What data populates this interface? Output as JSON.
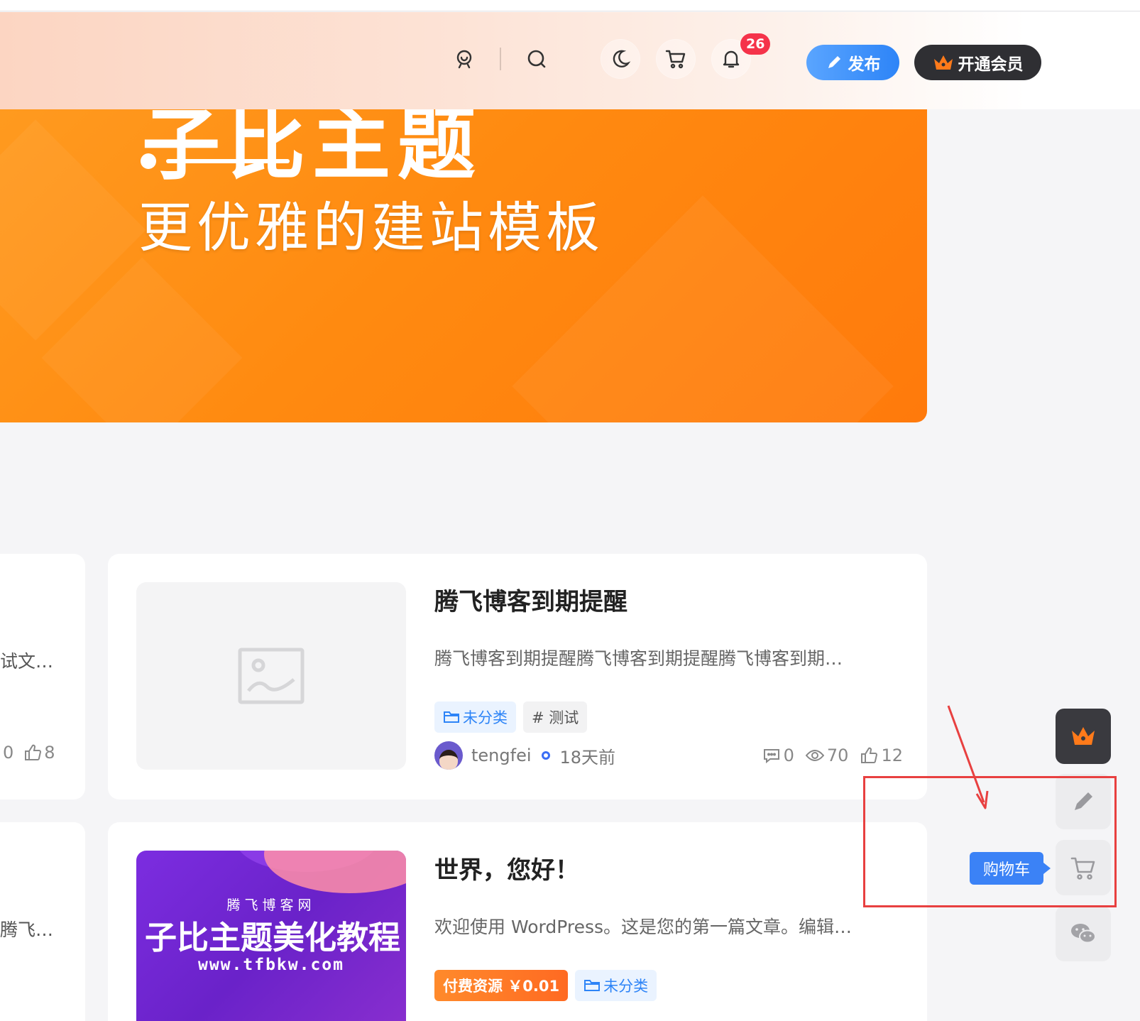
{
  "header": {
    "badge_count": "26",
    "publish_label": "发布",
    "vip_label": "开通会员"
  },
  "banner": {
    "title_partial": "子比主题",
    "subtitle": "更优雅的建站模板"
  },
  "left_column": {
    "row1_excerpt": "试文…",
    "row1_comments": "0",
    "row1_likes": "8",
    "row2_excerpt": "腾飞…"
  },
  "posts": [
    {
      "title": "腾飞博客到期提醒",
      "excerpt": "腾飞博客到期提醒腾飞博客到期提醒腾飞博客到期…",
      "tags": [
        "未分类",
        "# 测试"
      ],
      "author": "tengfei",
      "time": "18天前",
      "comments": "0",
      "views": "70",
      "likes": "12"
    },
    {
      "title": "世界，您好！",
      "excerpt": "欢迎使用 WordPress。这是您的第一篇文章。编辑…",
      "tags": [
        "付费资源 ￥0.01",
        "未分类"
      ],
      "thumb_sub": "腾飞博客网",
      "thumb_main": "子比主题美化教程",
      "thumb_url": "www.tfbkw.com"
    }
  ],
  "float_toolbar": {
    "tooltip": "购物车",
    "icons": [
      "crown-icon",
      "pencil-icon",
      "cart-icon",
      "wechat-icon"
    ]
  },
  "colors": {
    "banner": "#ff8a10",
    "publish": "#2d84f7",
    "vip": "#2f2f33",
    "badge": "#f5334a",
    "annotation": "#e84040"
  }
}
